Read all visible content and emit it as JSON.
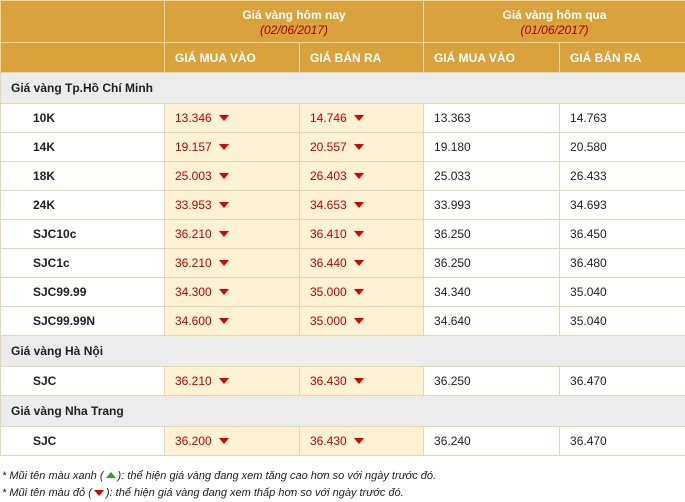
{
  "header": {
    "today_title": "Giá vàng hôm nay",
    "today_date": "(02/06/2017)",
    "yesterday_title": "Giá vàng hôm qua",
    "yesterday_date": "(01/06/2017)",
    "buy_label": "GIÁ MUA VÀO",
    "sell_label": "GIÁ BÁN RA"
  },
  "sections": [
    {
      "title": "Giá vàng Tp.Hồ Chí Minh",
      "rows": [
        {
          "name": "10K",
          "today_buy": "13.346",
          "today_sell": "14.746",
          "yest_buy": "13.363",
          "yest_sell": "14.763"
        },
        {
          "name": "14K",
          "today_buy": "19.157",
          "today_sell": "20.557",
          "yest_buy": "19.180",
          "yest_sell": "20.580"
        },
        {
          "name": "18K",
          "today_buy": "25.003",
          "today_sell": "26.403",
          "yest_buy": "25.033",
          "yest_sell": "26.433"
        },
        {
          "name": "24K",
          "today_buy": "33.953",
          "today_sell": "34.653",
          "yest_buy": "33.993",
          "yest_sell": "34.693"
        },
        {
          "name": "SJC10c",
          "today_buy": "36.210",
          "today_sell": "36.410",
          "yest_buy": "36.250",
          "yest_sell": "36.450"
        },
        {
          "name": "SJC1c",
          "today_buy": "36.210",
          "today_sell": "36.440",
          "yest_buy": "36.250",
          "yest_sell": "36.480"
        },
        {
          "name": "SJC99.99",
          "today_buy": "34.300",
          "today_sell": "35.000",
          "yest_buy": "34.340",
          "yest_sell": "35.040"
        },
        {
          "name": "SJC99.99N",
          "today_buy": "34.600",
          "today_sell": "35.000",
          "yest_buy": "34.640",
          "yest_sell": "35.040"
        }
      ]
    },
    {
      "title": "Giá vàng Hà Nội",
      "rows": [
        {
          "name": "SJC",
          "today_buy": "36.210",
          "today_sell": "36.430",
          "yest_buy": "36.250",
          "yest_sell": "36.470"
        }
      ]
    },
    {
      "title": "Giá vàng Nha Trang",
      "rows": [
        {
          "name": "SJC",
          "today_buy": "36.200",
          "today_sell": "36.430",
          "yest_buy": "36.240",
          "yest_sell": "36.470"
        }
      ]
    }
  ],
  "notes": {
    "green_prefix": "* Mũi tên màu xanh (",
    "green_suffix": "): thể hiện giá vàng đang xem tăng cao hơn so với ngày trước đó.",
    "red_prefix": "* Mũi tên màu đỏ (",
    "red_suffix": "): thể hiện giá vàng đang xem thấp hơn so với ngày trước đó."
  },
  "colors": {
    "header_bg": "#d9a23b",
    "date_red": "#a80000",
    "today_cell_bg": "#fdf3d4",
    "price_down_red": "#c30000",
    "arrow_up_green": "#2aa52a",
    "section_bg": "#ececec"
  },
  "icons": {
    "down": "down-arrow-icon",
    "up": "up-arrow-icon"
  }
}
